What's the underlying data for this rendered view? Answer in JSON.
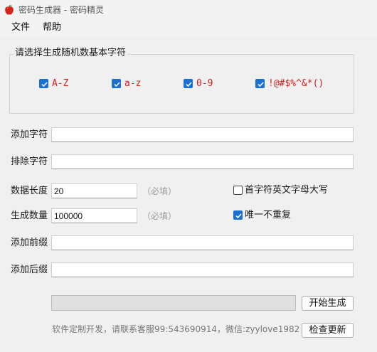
{
  "window": {
    "title": "密码生成器 - 密码精灵",
    "icon": "apple-icon",
    "accent": "#1a6fd1",
    "charset_color": "#d42020"
  },
  "menu": [
    {
      "label": "文件"
    },
    {
      "label": "帮助"
    }
  ],
  "charset_group": {
    "legend": "请选择生成随机数基本字符",
    "options": [
      {
        "label": "A-Z",
        "checked": true
      },
      {
        "label": "a-z",
        "checked": true
      },
      {
        "label": "0-9",
        "checked": true
      },
      {
        "label": "!@#$%^&*()",
        "checked": true
      }
    ]
  },
  "fields": {
    "add_chars": {
      "label": "添加字符",
      "value": ""
    },
    "remove_chars": {
      "label": "排除字符",
      "value": ""
    },
    "length": {
      "label": "数据长度",
      "value": "20",
      "hint": "（必填）"
    },
    "count": {
      "label": "生成数量",
      "value": "100000",
      "hint": "（必填）"
    },
    "prefix": {
      "label": "添加前缀",
      "value": ""
    },
    "suffix": {
      "label": "添加后缀",
      "value": ""
    }
  },
  "options": {
    "capitalize_first": {
      "label": "首字符英文字母大写",
      "checked": false
    },
    "unique": {
      "label": "唯一不重复",
      "checked": true
    }
  },
  "progress": {
    "value": 0
  },
  "buttons": {
    "generate": "开始生成",
    "check_update": "检查更新"
  },
  "footer": {
    "text": "软件定制开发，请联系客服99:543690914，微信:zyylove1982"
  }
}
